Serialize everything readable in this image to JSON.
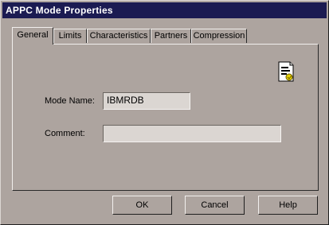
{
  "window": {
    "title": "APPC Mode Properties"
  },
  "tabs": [
    {
      "label": "General",
      "active": true
    },
    {
      "label": "Limits",
      "active": false
    },
    {
      "label": "Characteristics",
      "active": false
    },
    {
      "label": "Partners",
      "active": false
    },
    {
      "label": "Compression",
      "active": false
    }
  ],
  "general": {
    "mode_name_label": "Mode Name:",
    "mode_name_value": "IBMRDB",
    "comment_label": "Comment:",
    "comment_value": "",
    "icon": "properties-document-icon"
  },
  "buttons": {
    "ok": "OK",
    "cancel": "Cancel",
    "help": "Help"
  },
  "colors": {
    "title_bar": "#1b1b52",
    "dialog_face": "#ada49f",
    "field_bg": "#dbd6d2"
  }
}
